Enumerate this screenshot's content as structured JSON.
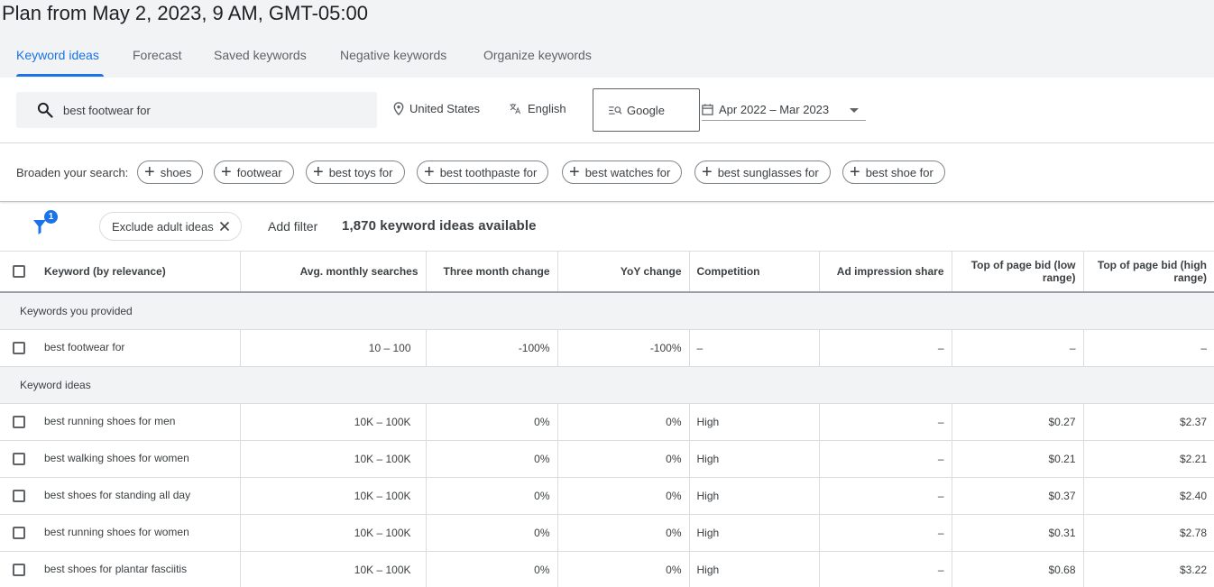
{
  "page": {
    "title": "Plan from May 2, 2023, 9 AM, GMT-05:00"
  },
  "tabs": [
    {
      "label": "Keyword ideas",
      "active": true
    },
    {
      "label": "Forecast"
    },
    {
      "label": "Saved keywords"
    },
    {
      "label": "Negative keywords"
    },
    {
      "label": "Organize keywords"
    }
  ],
  "search": {
    "value": "best footwear for",
    "location": "United States",
    "language": "English",
    "network": "Google",
    "date_range": "Apr 2022 – Mar 2023"
  },
  "broaden": {
    "label": "Broaden your search:",
    "chips": [
      "shoes",
      "footwear",
      "best toys for",
      "best toothpaste for",
      "best watches for",
      "best sunglasses for",
      "best shoe for"
    ]
  },
  "filters": {
    "badge": "1",
    "exclude_chip": "Exclude adult ideas",
    "add_filter": "Add filter",
    "ideas_count": "1,870 keyword ideas available"
  },
  "table": {
    "headers": [
      "Keyword (by relevance)",
      "Avg. monthly searches",
      "Three month change",
      "YoY change",
      "Competition",
      "Ad impression share",
      "Top of page bid (low range)",
      "Top of page bid (high range)"
    ],
    "section_provided": "Keywords you provided",
    "provided_rows": [
      {
        "keyword": "best footwear for",
        "searches": "10 – 100",
        "three_month": "-100%",
        "yoy": "-100%",
        "competition": "–",
        "impression": "–",
        "bid_low": "–",
        "bid_high": "–"
      }
    ],
    "section_ideas": "Keyword ideas",
    "idea_rows": [
      {
        "keyword": "best running shoes for men",
        "searches": "10K – 100K",
        "three_month": "0%",
        "yoy": "0%",
        "competition": "High",
        "impression": "–",
        "bid_low": "$0.27",
        "bid_high": "$2.37"
      },
      {
        "keyword": "best walking shoes for women",
        "searches": "10K – 100K",
        "three_month": "0%",
        "yoy": "0%",
        "competition": "High",
        "impression": "–",
        "bid_low": "$0.21",
        "bid_high": "$2.21"
      },
      {
        "keyword": "best shoes for standing all day",
        "searches": "10K – 100K",
        "three_month": "0%",
        "yoy": "0%",
        "competition": "High",
        "impression": "–",
        "bid_low": "$0.37",
        "bid_high": "$2.40"
      },
      {
        "keyword": "best running shoes for women",
        "searches": "10K – 100K",
        "three_month": "0%",
        "yoy": "0%",
        "competition": "High",
        "impression": "–",
        "bid_low": "$0.31",
        "bid_high": "$2.78"
      },
      {
        "keyword": "best shoes for plantar fasciitis",
        "searches": "10K – 100K",
        "three_month": "0%",
        "yoy": "0%",
        "competition": "High",
        "impression": "–",
        "bid_low": "$0.68",
        "bid_high": "$3.22"
      }
    ]
  },
  "icons": {
    "search": "search-icon",
    "location": "location-pin-icon",
    "language": "translate-icon",
    "network": "search-network-icon",
    "calendar": "calendar-icon",
    "filter": "filter-icon",
    "close": "close-icon"
  },
  "colors": {
    "accent": "#1a73e8",
    "text": "#3c4043",
    "header_bg": "#f1f3f4"
  }
}
